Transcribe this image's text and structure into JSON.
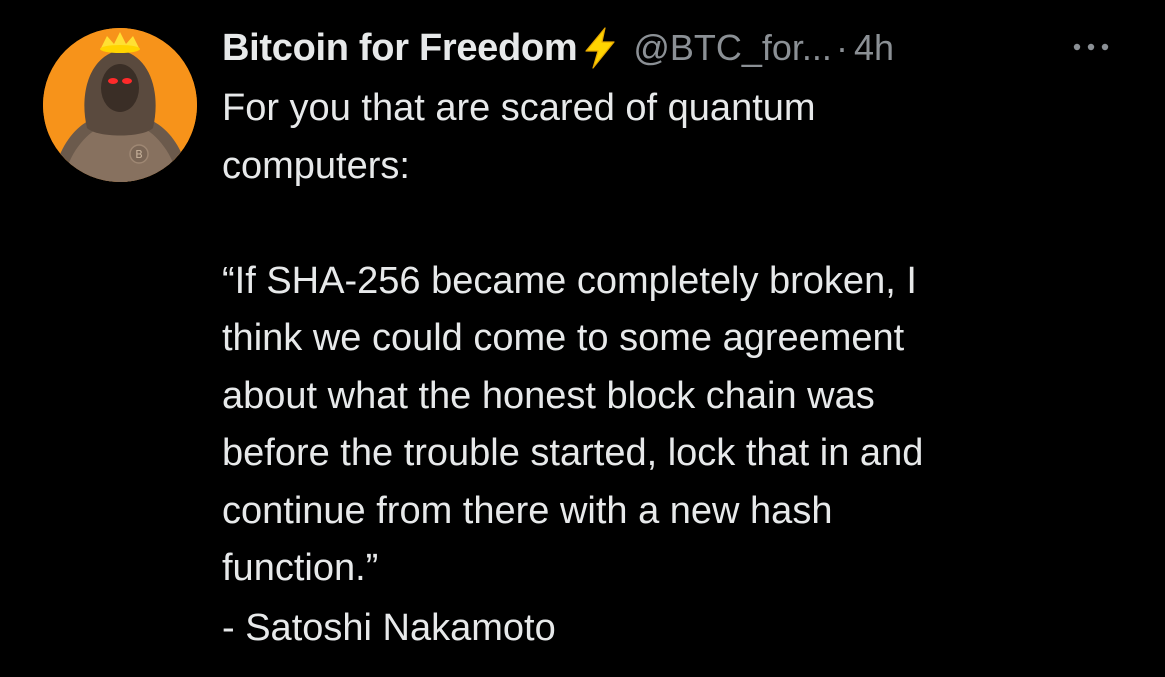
{
  "tweet": {
    "author": {
      "display_name": "Bitcoin for Freedom",
      "badge_icon": "lightning-bolt-icon",
      "handle": "@BTC_for...",
      "avatar_icon": "hooded-figure-avatar"
    },
    "separator": "·",
    "timestamp": "4h",
    "more_icon": "more-options-icon",
    "text": "For you that are scared of quantum\ncomputers:\n\n“If SHA-256 became completely broken, I\nthink we could come to some agreement\nabout what the honest block chain was\nbefore the trouble started, lock that in and\ncontinue from there with a new hash\nfunction.”",
    "attribution": "- Satoshi Nakamoto"
  },
  "colors": {
    "background": "#000000",
    "text_primary": "#e7e9ea",
    "text_secondary": "#8b9095",
    "bolt": "#ffd400",
    "avatar_bg": "#f7931a"
  }
}
